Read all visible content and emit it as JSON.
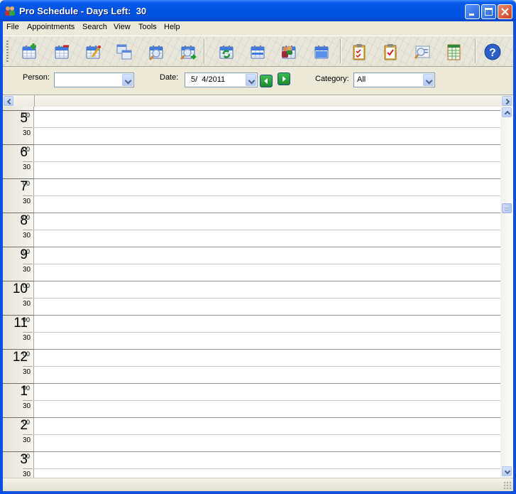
{
  "window": {
    "title": "Pro Schedule - Days Left:  30",
    "controls": [
      "minimize",
      "maximize",
      "close"
    ]
  },
  "menu": [
    "File",
    "Appointments",
    "Search",
    "View",
    "Tools",
    "Help"
  ],
  "toolbar": {
    "buttons": [
      {
        "name": "new-appointment",
        "icon": "calendar-add-icon"
      },
      {
        "name": "delete-appointment",
        "icon": "calendar-remove-icon"
      },
      {
        "name": "edit-appointment",
        "icon": "calendar-edit-icon"
      },
      {
        "name": "copy-appointment",
        "icon": "calendar-copy-icon"
      },
      {
        "name": "find-appointment",
        "icon": "calendar-search-icon"
      },
      {
        "name": "find-next",
        "icon": "calendar-search-next-icon"
      },
      {
        "name": "refresh",
        "icon": "calendar-refresh-icon"
      },
      {
        "name": "week-view",
        "icon": "calendar-week-icon"
      },
      {
        "name": "people-view",
        "icon": "calendar-people-icon"
      },
      {
        "name": "month-view",
        "icon": "calendar-month-icon"
      },
      {
        "name": "task-list",
        "icon": "clipboard-list-icon"
      },
      {
        "name": "task-check",
        "icon": "clipboard-check-icon"
      },
      {
        "name": "contact-search",
        "icon": "contact-card-search-icon"
      },
      {
        "name": "report",
        "icon": "spreadsheet-icon"
      },
      {
        "name": "help",
        "icon": "help-icon"
      }
    ]
  },
  "filters": {
    "person_label": "Person:",
    "person_value": "",
    "date_label": "Date:",
    "date_value": "5/  4/2011",
    "category_label": "Category:",
    "category_value": "All"
  },
  "schedule": {
    "hours": [
      {
        "hour": "5",
        "m00": "00",
        "m30": "30"
      },
      {
        "hour": "6",
        "m00": "00",
        "m30": "30"
      },
      {
        "hour": "7",
        "m00": "00",
        "m30": "30"
      },
      {
        "hour": "8",
        "m00": "00",
        "m30": "30"
      },
      {
        "hour": "9",
        "m00": "00",
        "m30": "30"
      },
      {
        "hour": "10",
        "m00": "00",
        "m30": "30"
      },
      {
        "hour": "11",
        "m00": "00",
        "m30": "30"
      },
      {
        "hour": "12",
        "m00": "00",
        "m30": "30"
      },
      {
        "hour": "1",
        "m00": "00",
        "m30": "30"
      },
      {
        "hour": "2",
        "m00": "00",
        "m30": "30"
      },
      {
        "hour": "3",
        "m00": "00",
        "m30": "30"
      }
    ]
  }
}
